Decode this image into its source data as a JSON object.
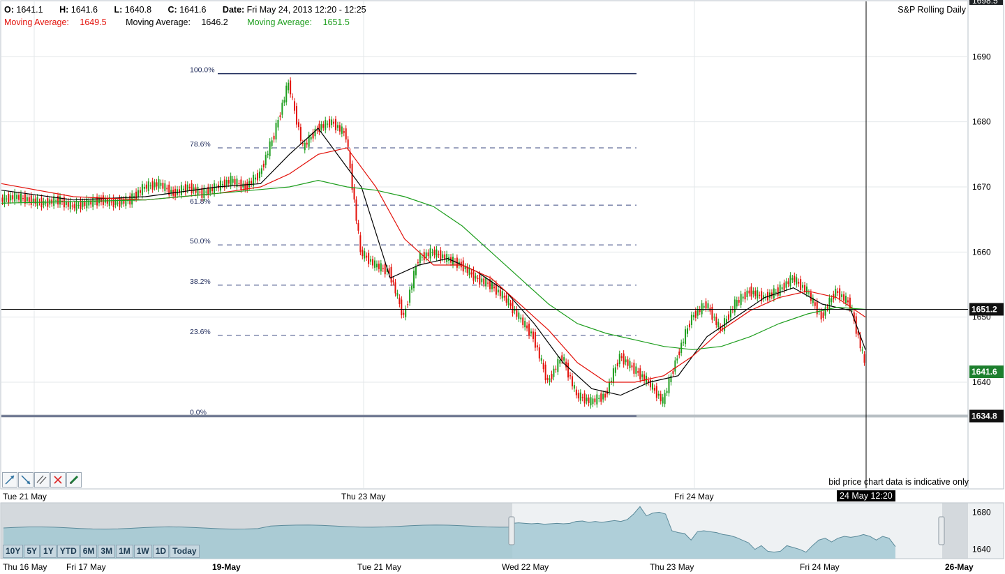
{
  "ohlc": {
    "open_label": "O:",
    "open": "1641.1",
    "high_label": "H:",
    "high": "1641.6",
    "low_label": "L:",
    "low": "1640.8",
    "close_label": "C:",
    "close": "1641.6",
    "date_label": "Date:",
    "date": "Fri May 24, 2013 12:20 - 12:25"
  },
  "moving_averages": [
    {
      "label": "Moving Average:",
      "value": "1649.5",
      "color": "#e3120b"
    },
    {
      "label": "Moving Average:",
      "value": "1646.2",
      "color": "#000000"
    },
    {
      "label": "Moving Average:",
      "value": "1651.5",
      "color": "#1e9e1e"
    }
  ],
  "chart_title": "S&P Rolling Daily",
  "disclaimer": "bid price chart data is indicative only",
  "crosshair_time": "24 May 12:20",
  "drawing_tools": [
    "trend-line-icon",
    "ray-icon",
    "parallel-channel-icon",
    "delete-icon",
    "pencil-icon"
  ],
  "range_buttons": [
    "10Y",
    "5Y",
    "1Y",
    "YTD",
    "6M",
    "3M",
    "1M",
    "1W",
    "1D",
    "Today"
  ],
  "colors": {
    "up": "#1e9e1e",
    "down": "#e3120b",
    "ma_fast": "#000000",
    "ma_mid": "#e3120b",
    "ma_slow": "#1e9e1e",
    "navigator": "#5b8a9a"
  },
  "chart_data": {
    "type": "line",
    "title": "S&P Rolling Daily",
    "y_ticks": [
      "1640",
      "1650",
      "1660",
      "1670",
      "1680",
      "1690"
    ],
    "y_top_label": "1698.5",
    "ylim": [
      1631,
      1698.5
    ],
    "x_labels": [
      "Tue 21 May",
      "Thu 23 May",
      "Fri 24 May"
    ],
    "price_labels": {
      "crosshair": "1651.2",
      "last": "1641.6",
      "low": "1634.8"
    },
    "fib_levels": [
      {
        "label": "100.0%",
        "value": 1687.4
      },
      {
        "label": "78.6%",
        "value": 1676.0
      },
      {
        "label": "61.8%",
        "value": 1667.2
      },
      {
        "label": "50.0%",
        "value": 1661.1
      },
      {
        "label": "38.2%",
        "value": 1654.9
      },
      {
        "label": "23.6%",
        "value": 1647.2
      },
      {
        "label": "0.0%",
        "value": 1634.8
      }
    ],
    "series": [
      {
        "name": "Price",
        "color": "#1e9e1e",
        "x": [
          0,
          1,
          2,
          3,
          4,
          5,
          6,
          7,
          8,
          9,
          10,
          11,
          12,
          13,
          14,
          15,
          16,
          17,
          18,
          19,
          20,
          21,
          22,
          23,
          24,
          25,
          26,
          27,
          28,
          29,
          30,
          31,
          32,
          33,
          34,
          35,
          36,
          37,
          38,
          39,
          40,
          41,
          42,
          43,
          44,
          45,
          46,
          47,
          48,
          49,
          50,
          51,
          52,
          53,
          54,
          55,
          56,
          57,
          58,
          59,
          60
        ],
        "values": [
          1668,
          1668.5,
          1668,
          1667.5,
          1668,
          1667,
          1667.5,
          1668,
          1667.5,
          1668,
          1670,
          1670.5,
          1669,
          1670,
          1669,
          1670,
          1671,
          1670,
          1672,
          1678,
          1686,
          1676,
          1679,
          1680,
          1678,
          1660,
          1658,
          1657,
          1650,
          1659,
          1660,
          1659,
          1658,
          1656,
          1655,
          1653,
          1650,
          1647,
          1640,
          1644,
          1638,
          1637,
          1638,
          1644,
          1642,
          1640,
          1637,
          1644,
          1650,
          1652,
          1648,
          1652,
          1654,
          1653,
          1654,
          1656,
          1654,
          1650,
          1654,
          1652,
          1643
        ]
      },
      {
        "name": "Moving Average",
        "color": "#000000",
        "x": [
          0,
          5,
          10,
          15,
          18,
          20,
          22,
          25,
          27,
          29,
          31,
          33,
          35,
          37,
          39,
          41,
          43,
          45,
          47,
          49,
          51,
          53,
          55,
          57,
          59,
          60
        ],
        "values": [
          1669.5,
          1668,
          1668.5,
          1670,
          1670.5,
          1675,
          1679,
          1670,
          1656,
          1658,
          1659,
          1657,
          1654,
          1649,
          1643,
          1639,
          1638,
          1640,
          1641,
          1647,
          1650,
          1653,
          1654.5,
          1652,
          1651,
          1645
        ]
      },
      {
        "name": "Moving Average",
        "color": "#e3120b",
        "x": [
          0,
          5,
          10,
          15,
          18,
          20,
          22,
          24,
          26,
          28,
          30,
          32,
          34,
          36,
          38,
          40,
          42,
          44,
          46,
          48,
          50,
          52,
          54,
          56,
          58,
          60
        ],
        "values": [
          1670.5,
          1668.5,
          1668,
          1669,
          1670,
          1672,
          1675,
          1676,
          1670,
          1662,
          1658,
          1658,
          1656,
          1652,
          1648,
          1643,
          1640,
          1640,
          1641,
          1644,
          1648,
          1651,
          1653,
          1654,
          1653,
          1650
        ]
      },
      {
        "name": "Moving Average",
        "color": "#1e9e1e",
        "x": [
          0,
          10,
          15,
          20,
          22,
          24,
          26,
          28,
          30,
          32,
          34,
          36,
          38,
          40,
          42,
          44,
          46,
          48,
          50,
          52,
          54,
          56,
          58,
          60
        ],
        "values": [
          1667.5,
          1668,
          1669,
          1670,
          1671,
          1670,
          1669.5,
          1668.5,
          1667,
          1664,
          1660,
          1656,
          1652,
          1649,
          1647.5,
          1646.5,
          1645.5,
          1645,
          1645.5,
          1647,
          1649,
          1650.5,
          1651.5,
          1651.2
        ]
      }
    ],
    "navigator": {
      "x_labels": [
        "Thu 16 May",
        "Fri 17 May",
        "19-May",
        "Tue 21 May",
        "Wed 22 May",
        "Thu 23 May",
        "Fri 24 May",
        "26-May"
      ],
      "y_ticks": [
        "1680",
        "1640"
      ]
    }
  }
}
